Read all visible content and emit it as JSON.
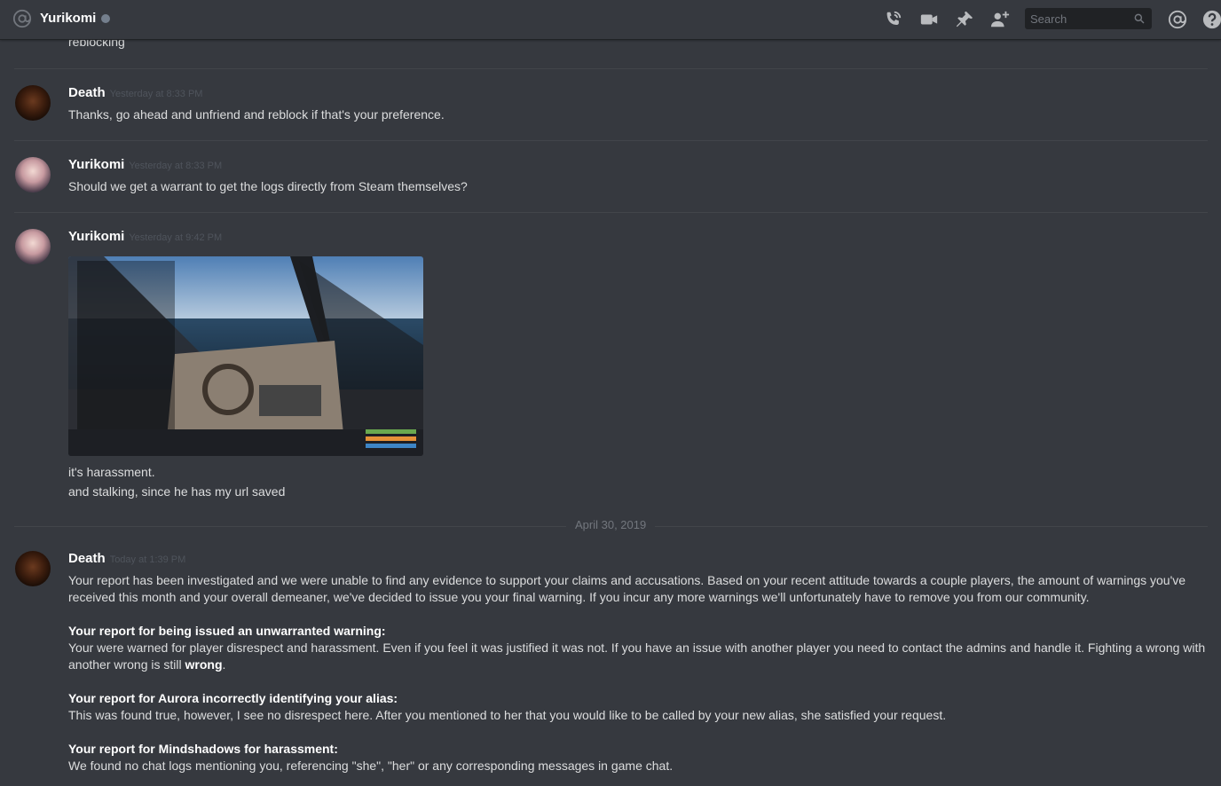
{
  "header": {
    "channel_name": "Yurikomi",
    "search_placeholder": "Search"
  },
  "icons": {
    "at": "at-sign-icon",
    "call": "phone-call-icon",
    "video": "video-camera-icon",
    "pin": "pin-icon",
    "add_friend": "add-friend-icon",
    "search": "magnifier-icon",
    "mentions": "mentions-icon",
    "help": "help-icon"
  },
  "colors": {
    "background": "#36393f",
    "header_border": "#202225",
    "status_offline": "#747f8d"
  },
  "messages": [
    {
      "text": "reblocking"
    },
    {
      "author": "Death",
      "timestamp": "Yesterday at 8:33 PM",
      "text": "Thanks, go ahead and unfriend and reblock if that's your preference."
    },
    {
      "author": "Yurikomi",
      "timestamp": "Yesterday at 8:33 PM",
      "text": "Should we get a warrant to get the logs directly from Steam themselves?"
    },
    {
      "author": "Yurikomi",
      "timestamp": "Yesterday at 9:42 PM",
      "lines": [
        "it's harassment.",
        "and stalking, since he has my url saved"
      ]
    }
  ],
  "date_separator": "April 30, 2019",
  "final_message": {
    "author": "Death",
    "timestamp": "Today at 1:39 PM",
    "intro": "Your report has been investigated and we were unable to find any evidence to support your claims and accusations. Based on your recent attitude towards a couple players, the amount of warnings you've received this month and your overall demeaner, we've decided to issue you your final warning. If you incur any more warnings we'll unfortunately have to remove you from our community.",
    "sections": [
      {
        "heading": "Your report for being issued an unwarranted warning:",
        "body": "Your were warned for player disrespect and harassment. Even if you feel it was justified it was not. If you have an issue with another player you need to contact the admins and handle it. Fighting a wrong with another wrong is still ",
        "emphasis": "wrong",
        "tail": "."
      },
      {
        "heading": "Your report for Aurora incorrectly identifying your alias:",
        "body": "This was found true, however, I see no disrespect here. After you mentioned to her that you would like to be called by your new alias, she satisfied your request."
      },
      {
        "heading": "Your report for Mindshadows for harassment:",
        "body": "We found no chat logs mentioning you, referencing \"she\", \"her\" or any corresponding messages in game chat."
      }
    ]
  }
}
